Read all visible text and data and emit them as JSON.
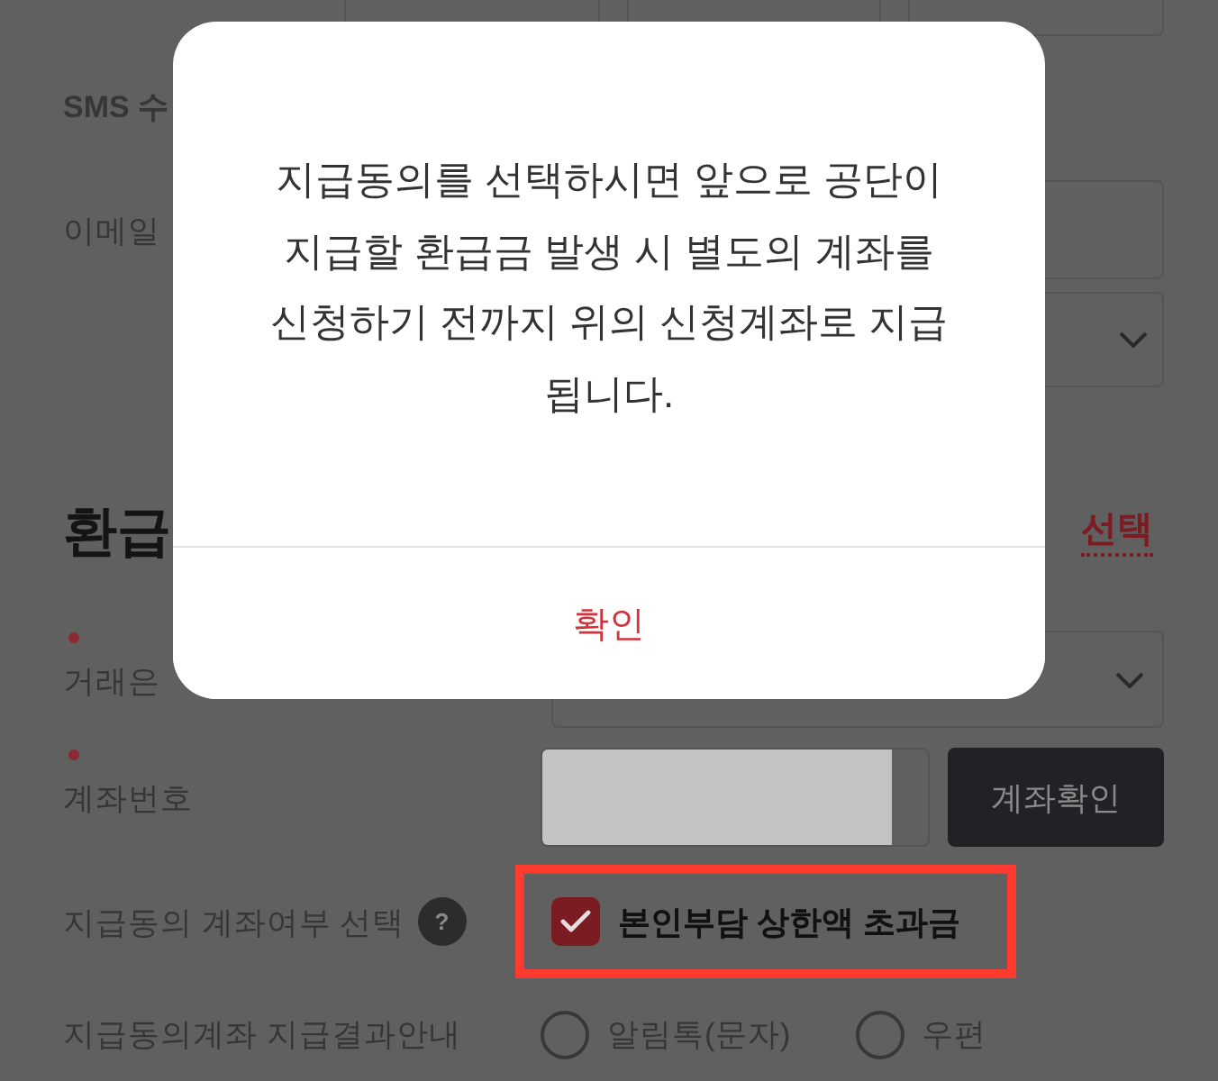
{
  "contact_rows": [
    {
      "kind": "text",
      "label": "SMS 수"
    },
    {
      "kind": "input",
      "label": "이메일"
    },
    {
      "kind": "select"
    }
  ],
  "refund_section": {
    "title": "환급",
    "link": "선택",
    "rows": [
      {
        "kind": "select",
        "label": "거래은",
        "required": true
      },
      {
        "kind": "account",
        "label": "계좌번호",
        "required": true,
        "value_hidden": true,
        "button": "계좌확인"
      },
      {
        "kind": "checkbox",
        "label": "지급동의 계좌여부 선택",
        "required": false,
        "help": "?",
        "highlighted": true,
        "option": {
          "label": "본인부담 상한액 초과금",
          "checked": true
        }
      },
      {
        "kind": "radio",
        "label": "지급동의계좌 지급결과안내",
        "required": false,
        "options": [
          {
            "label": "알림톡(문자)",
            "selected": false
          },
          {
            "label": "우편",
            "selected": false
          }
        ]
      }
    ]
  },
  "dialog": {
    "message_lines": [
      "지급동의를 선택하시면 앞으로 공단이",
      "지급할 환급금 발생 시 별도의 계좌를",
      "신청하기 전까지 위의 신청계좌로 지급",
      "됩니다."
    ],
    "button": "확인"
  }
}
